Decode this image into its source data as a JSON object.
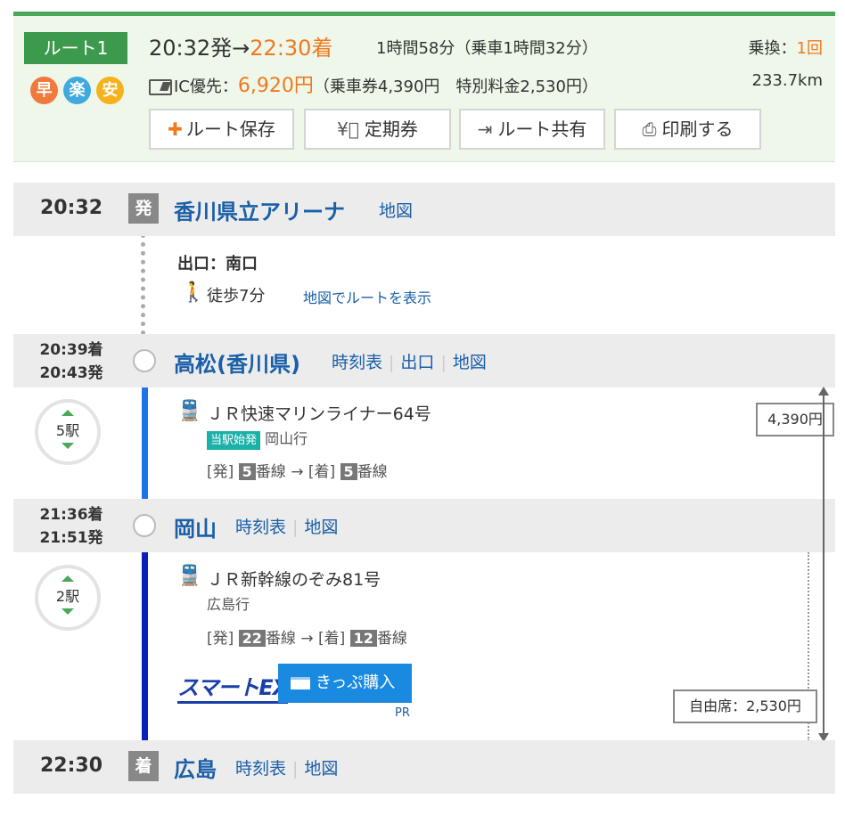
{
  "summary": {
    "route_label": "ルート1",
    "features": [
      {
        "label": "早",
        "color": "#f07a3c"
      },
      {
        "label": "楽",
        "color": "#3fa9e0"
      },
      {
        "label": "安",
        "color": "#f5b21c"
      }
    ],
    "depart": "20:32発",
    "arrow": "→",
    "arrive": "22:30着",
    "duration": "1時間58分（乗車1時間32分）",
    "transfer_label": "乗換：",
    "transfer_count": "1回",
    "ic_label": "IC優先：",
    "ic_price": "6,920円",
    "ic_breakdown": "（乗車券4,390円　特別料金2,530円）",
    "distance": "233.7km",
    "buttons": {
      "save": "ルート保存",
      "pass": "定期券",
      "share": "ルート共有",
      "print": "印刷する"
    }
  },
  "origin": {
    "time": "20:32",
    "badge": "発",
    "name": "香川県立アリーナ",
    "map": "地図",
    "exit": "出口：南口",
    "walk": "徒歩7分",
    "walk_map": "地図でルートを表示"
  },
  "takamatsu": {
    "arr": "20:39着",
    "dep": "20:43発",
    "name": "高松(香川県)",
    "links": [
      "時刻表",
      "出口",
      "地図"
    ]
  },
  "seg1": {
    "stops": "5駅",
    "train": "ＪＲ快速マリンライナー64号",
    "tag": "当駅始発",
    "dest": "岡山行",
    "from_label": "[発]",
    "from_num": "5",
    "from_suffix": "番線",
    "arrow": "→",
    "to_label": "[着]",
    "to_num": "5",
    "to_suffix": "番線",
    "fare": "4,390円"
  },
  "okayama": {
    "arr": "21:36着",
    "dep": "21:51発",
    "name": "岡山",
    "links": [
      "時刻表",
      "地図"
    ]
  },
  "seg2": {
    "stops": "2駅",
    "train": "ＪＲ新幹線のぞみ81号",
    "dest": "広島行",
    "from_label": "[発]",
    "from_num": "22",
    "from_suffix": "番線",
    "arrow": "→",
    "to_label": "[着]",
    "to_num": "12",
    "to_suffix": "番線",
    "smartex": "スマートEX",
    "buy": "きっぷ購入",
    "pr": "PR",
    "fare": "自由席：2,530円"
  },
  "hiroshima": {
    "time": "22:30",
    "badge": "着",
    "name": "広島",
    "links": [
      "時刻表",
      "地図"
    ]
  },
  "colors": {
    "accent": "#4aa75b",
    "orange": "#ef7a1d",
    "link": "#1a5fa8",
    "line_local": "#1e73e8",
    "line_shinkansen": "#0a1fb5"
  }
}
